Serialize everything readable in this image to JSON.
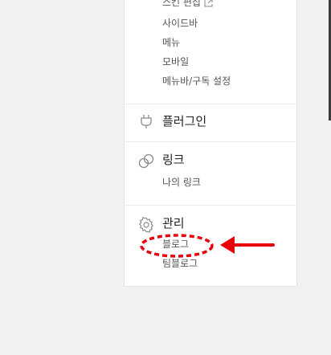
{
  "design_section": {
    "items": [
      {
        "label": "스킨 편집"
      },
      {
        "label": "사이드바"
      },
      {
        "label": "메뉴"
      },
      {
        "label": "모바일"
      },
      {
        "label": "메뉴바/구독 설정"
      }
    ]
  },
  "plugin_section": {
    "title": "플러그인",
    "icon": "plug-icon"
  },
  "link_section": {
    "title": "링크",
    "icon": "link-icon",
    "items": [
      {
        "label": "나의 링크"
      }
    ]
  },
  "manage_section": {
    "title": "관리",
    "icon": "gear-icon",
    "items": [
      {
        "label": "블로그"
      },
      {
        "label": "팀블로그"
      }
    ]
  },
  "annotation": {
    "color": "#e8000b",
    "highlighted_item": "블로그"
  }
}
